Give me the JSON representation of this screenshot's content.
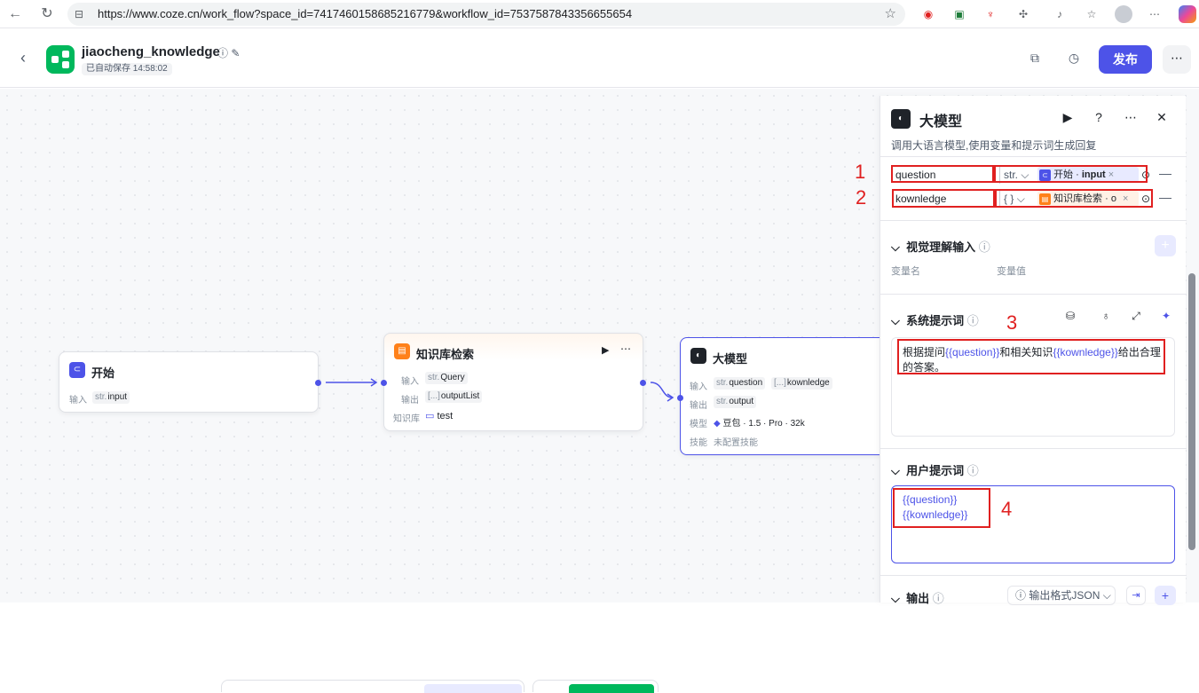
{
  "browser": {
    "url": "https://www.coze.cn/work_flow?space_id=7417460158685216779&workflow_id=7537587843356655654"
  },
  "header": {
    "title": "jiaocheng_knowledge",
    "saved": "已自动保存 14:58:02",
    "publish_label": "发布"
  },
  "nodes": {
    "start": {
      "title": "开始",
      "input_label": "输入",
      "input_type": "str.",
      "input_name": "input"
    },
    "knowledge": {
      "title": "知识库检索",
      "input_label": "输入",
      "input_type": "str.",
      "input_name": "Query",
      "output_label": "输出",
      "output_type": "[...]",
      "output_name": "outputList",
      "kb_label": "知识库",
      "kb_name": "test"
    },
    "llm": {
      "title": "大模型",
      "input_label": "输入",
      "in1_type": "str.",
      "in1_name": "question",
      "in2_type": "[...]",
      "in2_name": "kownledge",
      "output_label": "输出",
      "out_type": "str.",
      "out_name": "output",
      "model_label": "模型",
      "model_value": "豆包 · 1.5 · Pro · 32k",
      "skill_label": "技能",
      "skill_value": "未配置技能"
    }
  },
  "panel": {
    "title": "大模型",
    "description": "调用大语言模型,使用变量和提示词生成回复",
    "inputs": [
      {
        "name": "question",
        "type": "str.",
        "ref_node": "开始",
        "ref_var": "input"
      },
      {
        "name": "kownledge",
        "type": "{ }",
        "ref_node": "知识库检索",
        "ref_var": "o"
      }
    ],
    "vision": {
      "title": "视觉理解输入",
      "col_name": "变量名",
      "col_value": "变量值"
    },
    "system_prompt": {
      "title": "系统提示词",
      "text_before": "根据提问",
      "var1": "{{question}}",
      "text_mid": "和相关知识",
      "var2": "{{kownledge}}",
      "text_after": "给出合理的答案。"
    },
    "user_prompt": {
      "title": "用户提示词",
      "line1": "{{question}}",
      "line2": "{{kownledge}}"
    },
    "output": {
      "title": "输出",
      "format": "输出格式JSON"
    }
  },
  "annotations": [
    "1",
    "2",
    "3",
    "4"
  ],
  "colors": {
    "accent": "#4d53e8",
    "annotation": "#e02020",
    "knowledge_icon": "#ff811a",
    "start_icon": "#4d53e8"
  }
}
